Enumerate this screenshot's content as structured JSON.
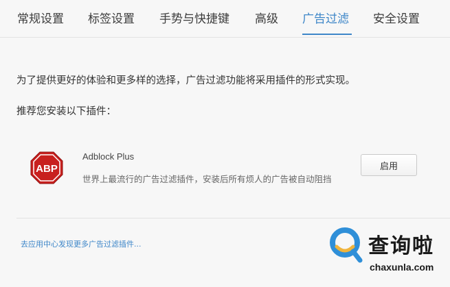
{
  "tabs": [
    {
      "label": "常规设置",
      "active": false
    },
    {
      "label": "标签设置",
      "active": false
    },
    {
      "label": "手势与快捷键",
      "active": false
    },
    {
      "label": "高级",
      "active": false
    },
    {
      "label": "广告过滤",
      "active": true
    },
    {
      "label": "安全设置",
      "active": false
    }
  ],
  "content": {
    "intro": "为了提供更好的体验和更多样的选择，广告过滤功能将采用插件的形式实现。",
    "recommend": "推荐您安装以下插件：",
    "plugin": {
      "logo_text": "ABP",
      "name": "Adblock Plus",
      "description": "世界上最流行的广告过滤插件，安装后所有烦人的广告被自动阻挡",
      "button_label": "启用"
    },
    "more_link": "去应用中心发现更多广告过滤插件..."
  },
  "watermark": {
    "text": "查询啦",
    "domain": "chaxunla.com"
  },
  "colors": {
    "accent": "#3d86c8",
    "abp_red": "#c8201e",
    "watermark_blue": "#2f8fd8"
  }
}
